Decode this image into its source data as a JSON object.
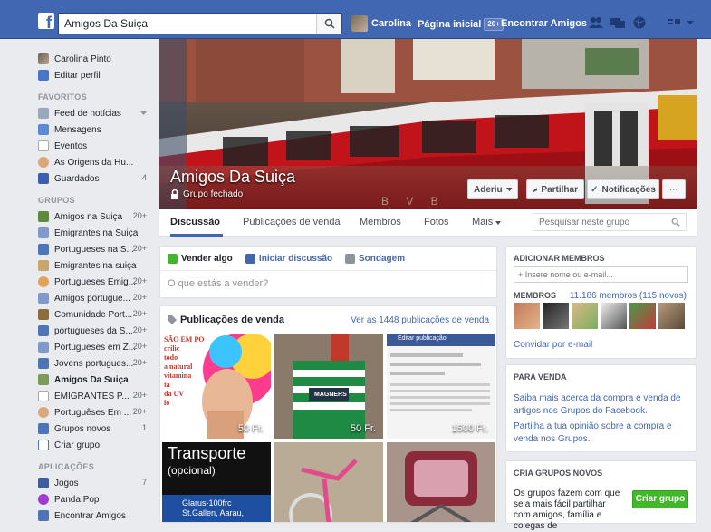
{
  "topbar": {
    "search_value": "Amigos Da Suiça",
    "user_name": "Carolina",
    "home_label": "Página inicial",
    "home_badge": "20+",
    "find_friends": "Encontrar Amigos"
  },
  "sidebar": {
    "profile": [
      {
        "label": "Carolina Pinto",
        "icon": "profile-avatar"
      },
      {
        "label": "Editar perfil",
        "icon": "pencil-icon"
      }
    ],
    "favorites_header": "FAVORITOS",
    "favorites": [
      {
        "label": "Feed de notícias",
        "icon": "news-feed-icon",
        "count": ""
      },
      {
        "label": "Mensagens",
        "icon": "messages-icon",
        "count": ""
      },
      {
        "label": "Eventos",
        "icon": "calendar-icon",
        "count": ""
      },
      {
        "label": "As Origens da Hu...",
        "icon": "group-icon",
        "count": ""
      },
      {
        "label": "Guardados",
        "icon": "bookmark-icon",
        "count": "4"
      }
    ],
    "groups_header": "GRUPOS",
    "groups": [
      {
        "label": "Amigos na Suiça",
        "count": "20+"
      },
      {
        "label": "Emigrantes na Suiça",
        "count": ""
      },
      {
        "label": "Portugueses na S...",
        "count": "20+"
      },
      {
        "label": "Emigrantes na suiça",
        "count": ""
      },
      {
        "label": "Portugueses Emig...",
        "count": "20+"
      },
      {
        "label": "Amigos portugue...",
        "count": "20+"
      },
      {
        "label": "Comunidade Port...",
        "count": "20+"
      },
      {
        "label": "portugueses da S...",
        "count": "20+"
      },
      {
        "label": "Portugueses em Z...",
        "count": "20+"
      },
      {
        "label": "Jovens portugues...",
        "count": "20+"
      },
      {
        "label": "Amigos Da Suiça",
        "count": ""
      },
      {
        "label": "EMIGRANTES P...",
        "count": "20+"
      },
      {
        "label": "Portuguêses Em ...",
        "count": "20+"
      },
      {
        "label": "Grupos novos",
        "count": "1"
      },
      {
        "label": "Criar grupo",
        "count": ""
      }
    ],
    "apps_header": "APLICAÇÕES",
    "apps": [
      {
        "label": "Jogos",
        "count": "7"
      },
      {
        "label": "Panda Pop",
        "count": ""
      },
      {
        "label": "Encontrar Amigos",
        "count": ""
      }
    ]
  },
  "cover": {
    "group_name": "Amigos Da Suiça",
    "privacy": "Grupo fechado",
    "joined_label": "Aderiu",
    "share_label": "Partilhar",
    "notifications_label": "Notificações",
    "more_label": "···",
    "train_text": "B V B"
  },
  "tabs": [
    {
      "label": "Discussão",
      "active": true
    },
    {
      "label": "Publicações de venda",
      "active": false
    },
    {
      "label": "Membros",
      "active": false
    },
    {
      "label": "Fotos",
      "active": false
    },
    {
      "label": "Mais",
      "active": false
    }
  ],
  "group_search_placeholder": "Pesquisar neste grupo",
  "composer": {
    "tabs": [
      "Vender algo",
      "Iniciar discussão",
      "Sondagem"
    ],
    "placeholder": "O que estás a vender?"
  },
  "sales": {
    "title": "Publicações de venda",
    "see_all": "Ver as 1448 publicações de venda",
    "items": [
      {
        "price": "50 Fr.",
        "overlay": "SÃO EM PO\ncrilic\ntodo\na natural\nvitamina\nta\nda UV\nio"
      },
      {
        "price": "50 Fr.",
        "overlay": "MAGNERS"
      },
      {
        "price": "1500 Fr.",
        "overlay": "Editar publicação"
      },
      {
        "price": "",
        "overlay": "Transporte"
      },
      {
        "price": "",
        "overlay": ""
      },
      {
        "price": "",
        "overlay": ""
      }
    ],
    "transport_title": "Transporte",
    "transport_sub": "(opcional)",
    "transport_addr": "Glarus-100frc\nSt.Gallen, Aarau,"
  },
  "add_members": {
    "header": "ADICIONAR MEMBROS",
    "input_placeholder": "+ Insere nome ou e-mail...",
    "members_label": "MEMBROS",
    "members_count": "11.186 membros (115 novos)",
    "invite_email": "Convidar por e-mail"
  },
  "for_sale": {
    "header": "PARA VENDA",
    "link1": "Saiba mais acerca da compra e venda de artigos nos Grupos do Facebook.",
    "link2": "Partilha a tua opinião sobre a compra e venda nos Grupos."
  },
  "create_groups": {
    "header": "CRIA GRUPOS NOVOS",
    "text": "Os grupos fazem com que seja mais fácil partilhar com amigos, família e colegas de",
    "button": "Criar grupo"
  },
  "colors": {
    "fb_blue": "#4267b2",
    "link_blue": "#4267b2",
    "create_green": "#42b72a"
  }
}
